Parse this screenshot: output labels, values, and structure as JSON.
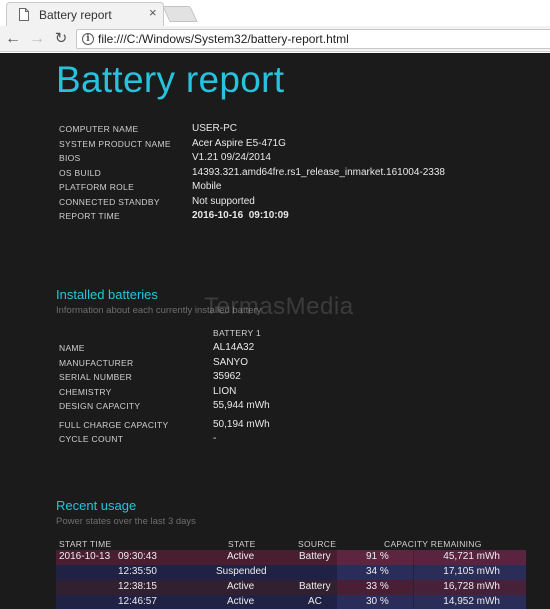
{
  "browser": {
    "tab_title": "Battery report",
    "tab_close": "×",
    "url": "file:///C:/Windows/System32/battery-report.html",
    "back_glyph": "←",
    "forward_glyph": "→",
    "reload_glyph": "↻",
    "info_glyph": "i"
  },
  "report": {
    "title": "Battery report",
    "system_info": [
      {
        "label": "COMPUTER NAME",
        "value": "USER-PC"
      },
      {
        "label": "SYSTEM PRODUCT NAME",
        "value": "Acer Aspire E5-471G"
      },
      {
        "label": "BIOS",
        "value": "V1.21 09/24/2014"
      },
      {
        "label": "OS BUILD",
        "value": "14393.321.amd64fre.rs1_release_inmarket.161004-2338"
      },
      {
        "label": "PLATFORM ROLE",
        "value": "Mobile"
      },
      {
        "label": "CONNECTED STANDBY",
        "value": "Not supported"
      },
      {
        "label": "REPORT TIME",
        "value": "2016-10-16  09:10:09"
      }
    ],
    "installed_batteries": {
      "heading": "Installed batteries",
      "subheading": "Information about each currently installed battery",
      "column_header": "BATTERY 1",
      "rows": [
        {
          "label": "NAME",
          "value": "AL14A32"
        },
        {
          "label": "MANUFACTURER",
          "value": "SANYO"
        },
        {
          "label": "SERIAL NUMBER",
          "value": "35962"
        },
        {
          "label": "CHEMISTRY",
          "value": "LION"
        },
        {
          "label": "DESIGN CAPACITY",
          "value": "55,944 mWh"
        },
        {
          "label": "FULL CHARGE CAPACITY",
          "value": "50,194 mWh"
        },
        {
          "label": "CYCLE COUNT",
          "value": "-"
        }
      ]
    },
    "recent_usage": {
      "heading": "Recent usage",
      "subheading": "Power states over the last 3 days",
      "columns": {
        "start_time": "START TIME",
        "state": "STATE",
        "source": "SOURCE",
        "capacity": "CAPACITY REMAINING"
      },
      "rows": [
        {
          "date": "2016-10-13",
          "time": "09:30:43",
          "state": "Active",
          "source": "Battery",
          "percent": "91 %",
          "mwh": "45,721 mWh"
        },
        {
          "date": "",
          "time": "12:35:50",
          "state": "Suspended",
          "source": "",
          "percent": "34 %",
          "mwh": "17,105 mWh"
        },
        {
          "date": "",
          "time": "12:38:15",
          "state": "Active",
          "source": "Battery",
          "percent": "33 %",
          "mwh": "16,728 mWh"
        },
        {
          "date": "",
          "time": "12:46:57",
          "state": "Active",
          "source": "AC",
          "percent": "30 %",
          "mwh": "14,952 mWh"
        }
      ]
    },
    "watermark": "TermasMedia"
  },
  "colors": {
    "accent": "#27c3de",
    "page_background": "#1b1b1b"
  }
}
